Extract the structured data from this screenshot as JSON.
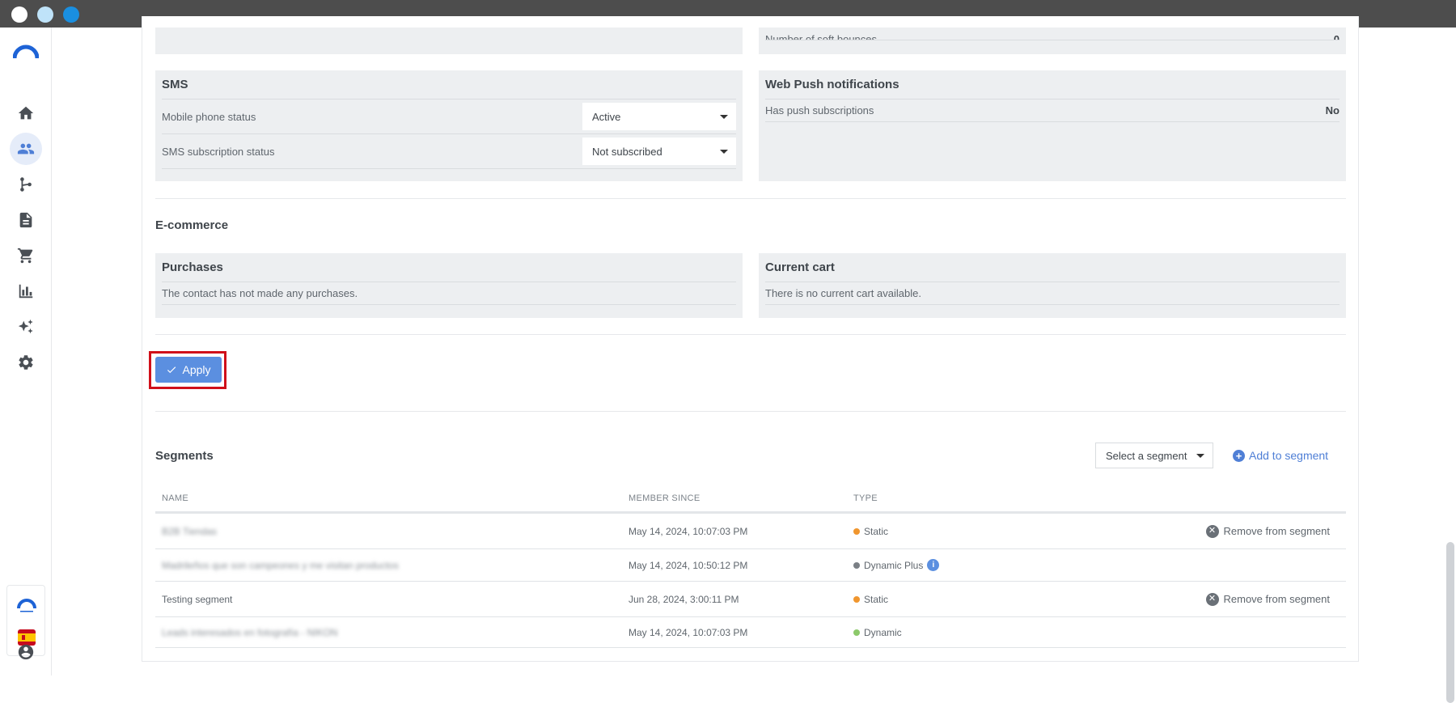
{
  "window": {
    "controls": [
      "close",
      "minimize",
      "maximize"
    ]
  },
  "sidebar": {
    "items": [
      {
        "name": "home",
        "icon": "home-icon"
      },
      {
        "name": "contacts",
        "icon": "contacts-icon",
        "active": true
      },
      {
        "name": "automation",
        "icon": "branch-icon"
      },
      {
        "name": "content",
        "icon": "document-icon"
      },
      {
        "name": "ecommerce",
        "icon": "cart-icon"
      },
      {
        "name": "reports",
        "icon": "bar-chart-icon"
      },
      {
        "name": "ai",
        "icon": "sparkles-icon"
      },
      {
        "name": "settings",
        "icon": "gear-icon"
      }
    ]
  },
  "email_panel": {
    "soft_bounces_label": "Number of soft bounces",
    "soft_bounces_value": "0"
  },
  "sms": {
    "title": "SMS",
    "mobile_label": "Mobile phone status",
    "mobile_value": "Active",
    "subscription_label": "SMS subscription status",
    "subscription_value": "Not subscribed"
  },
  "web_push": {
    "title": "Web Push notifications",
    "has_push_label": "Has push subscriptions",
    "has_push_value": "No"
  },
  "ecommerce": {
    "title": "E-commerce",
    "purchases_title": "Purchases",
    "purchases_text": "The contact has not made any purchases.",
    "cart_title": "Current cart",
    "cart_text": "There is no current cart available."
  },
  "apply_label": "Apply",
  "segments": {
    "title": "Segments",
    "select_placeholder": "Select a segment",
    "add_label": "Add to segment",
    "columns": [
      "NAME",
      "MEMBER SINCE",
      "TYPE"
    ],
    "remove_label": "Remove from segment",
    "rows": [
      {
        "name": "B2B Tiendas",
        "blurred": true,
        "since": "May 14, 2024, 10:07:03 PM",
        "type": "Static",
        "color": "#f0962e",
        "removable": true
      },
      {
        "name": "Madrileños que son campeones y me visitan productos",
        "blurred": true,
        "since": "May 14, 2024, 10:50:12 PM",
        "type": "Dynamic Plus",
        "color": "#7a7f85",
        "info": true
      },
      {
        "name": "Testing segment",
        "blurred": false,
        "since": "Jun 28, 2024, 3:00:11 PM",
        "type": "Static",
        "color": "#f0962e",
        "removable": true
      },
      {
        "name": "Leads interesados en fotografía - NIKON",
        "blurred": true,
        "since": "May 14, 2024, 10:07:03 PM",
        "type": "Dynamic",
        "color": "#8cc96a"
      }
    ]
  },
  "colors": {
    "accent": "#5b8fe0",
    "highlight": "#d0101a",
    "titlebar": "#4d4d4d"
  }
}
